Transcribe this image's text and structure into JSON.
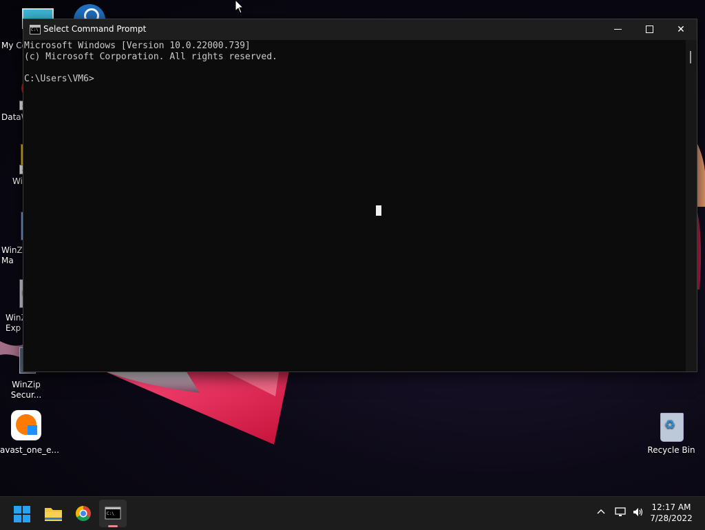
{
  "desktop": {
    "icons": [
      {
        "label": "My Co"
      },
      {
        "label": ""
      },
      {
        "label": "DataW"
      },
      {
        "label": "Wi"
      },
      {
        "label": "WinZi\nMa"
      },
      {
        "label": "WinZ\nExp"
      },
      {
        "label": "WinZip\nSecur..."
      },
      {
        "label": "avast_one_e..."
      },
      {
        "label": "Recycle Bin"
      }
    ]
  },
  "cmd": {
    "title": "Select Command Prompt",
    "icon_text": "C:\\",
    "lines": [
      "Microsoft Windows [Version 10.0.22000.739]",
      "(c) Microsoft Corporation. All rights reserved.",
      "",
      "C:\\Users\\VM6>"
    ],
    "close_glyph": "✕"
  },
  "taskbar": {
    "icons": [
      "windows-start-icon",
      "file-explorer-icon",
      "chrome-icon",
      "command-prompt-icon"
    ],
    "tray_chevron": "^",
    "time": "12:17 AM",
    "date": "7/28/2022"
  },
  "colors": {
    "console_bg": "#0c0c0c",
    "console_text": "#cccccc",
    "titlebar": "#1e1e1e",
    "taskbar": "#1c1c1c",
    "accent_windows": "#29a3f0"
  }
}
